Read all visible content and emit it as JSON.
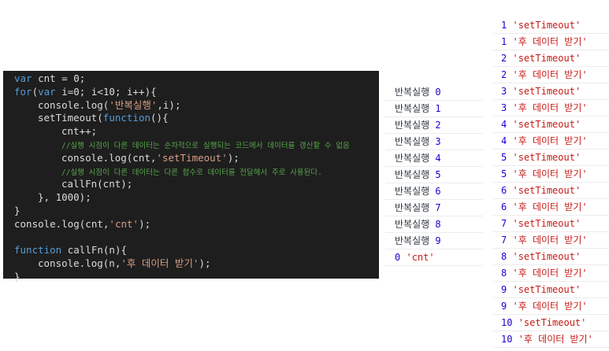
{
  "editor": {
    "lines": [
      {
        "kw": "var",
        "rest": " cnt = 0;"
      },
      {
        "kw": "for",
        "p1": "(",
        "kw2": "var",
        "p2": " i=0; i<10; i++){"
      },
      {
        "pre": "console.log(",
        "str": "'반복실행'",
        "post": ",i);"
      },
      {
        "pre": "setTimeout(",
        "kw": "function",
        "post": "(){"
      },
      {
        "text": "cnt++;"
      },
      {
        "comment": "//실행 시점이 다른 데이터는 순차적으로 실행되는 코드에서 데이터를 갱신할 수 없음"
      },
      {
        "pre": "console.log(cnt,",
        "str": "'setTimeout'",
        "post": ");"
      },
      {
        "comment": "//실행 시점이 다른 데이터는 다른 함수로 데이터를 전달해서 주로 사용된다."
      },
      {
        "text": "callFn(cnt);"
      },
      {
        "text": "}, 1000);"
      },
      {
        "text": "}"
      },
      {
        "pre": "console.log(cnt,",
        "str": "'cnt'",
        "post": ");"
      },
      {
        "text": ""
      },
      {
        "kw": "function",
        "rest": " callFn(n){"
      },
      {
        "pre": "console.log(n,",
        "str": "'후 데이터 받기'",
        "post": ");"
      },
      {
        "text": "}"
      }
    ]
  },
  "console_loop": {
    "label": "반복실행",
    "rows": [
      "0",
      "1",
      "2",
      "3",
      "4",
      "5",
      "6",
      "7",
      "8",
      "9"
    ],
    "final_num": "0",
    "final_str": "'cnt'"
  },
  "console_timeout": {
    "rows": [
      {
        "n": "1",
        "s": "'setTimeout'"
      },
      {
        "n": "1",
        "s": "'후 데이터 받기'"
      },
      {
        "n": "2",
        "s": "'setTimeout'"
      },
      {
        "n": "2",
        "s": "'후 데이터 받기'"
      },
      {
        "n": "3",
        "s": "'setTimeout'"
      },
      {
        "n": "3",
        "s": "'후 데이터 받기'"
      },
      {
        "n": "4",
        "s": "'setTimeout'"
      },
      {
        "n": "4",
        "s": "'후 데이터 받기'"
      },
      {
        "n": "5",
        "s": "'setTimeout'"
      },
      {
        "n": "5",
        "s": "'후 데이터 받기'"
      },
      {
        "n": "6",
        "s": "'setTimeout'"
      },
      {
        "n": "6",
        "s": "'후 데이터 받기'"
      },
      {
        "n": "7",
        "s": "'setTimeout'"
      },
      {
        "n": "7",
        "s": "'후 데이터 받기'"
      },
      {
        "n": "8",
        "s": "'setTimeout'"
      },
      {
        "n": "8",
        "s": "'후 데이터 받기'"
      },
      {
        "n": "9",
        "s": "'setTimeout'"
      },
      {
        "n": "9",
        "s": "'후 데이터 받기'"
      },
      {
        "n": "10",
        "s": "'setTimeout'"
      },
      {
        "n": "10",
        "s": "'후 데이터 받기'"
      }
    ]
  }
}
